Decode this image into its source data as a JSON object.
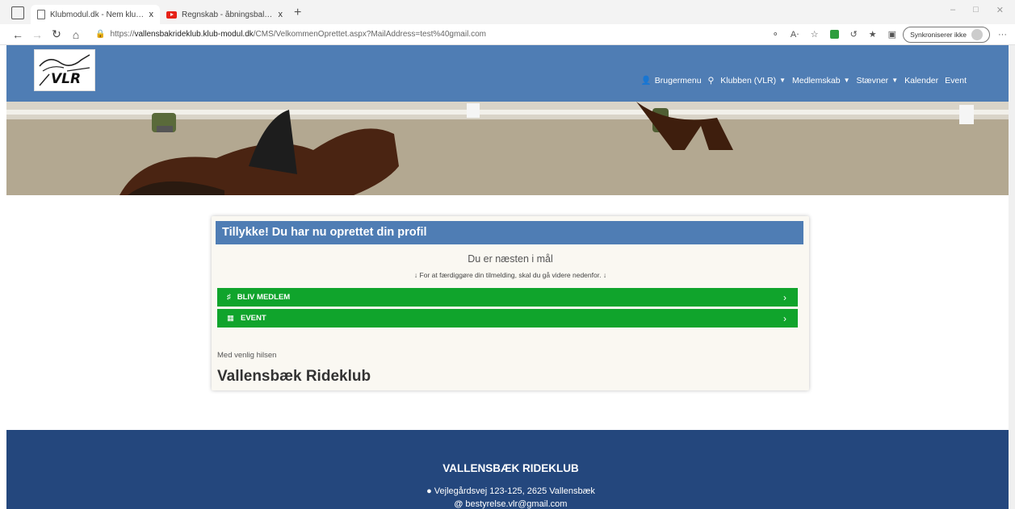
{
  "browser": {
    "tabs": [
      {
        "title": "Klubmodul.dk - Nem klubadmin",
        "close": "x",
        "favicon": "page-icon"
      },
      {
        "title": "Regnskab - åbningsbalance - Yo",
        "close": "x",
        "favicon": "youtube-icon"
      }
    ],
    "new_tab": "+",
    "url_scheme": "https://",
    "url_host": "vallensbakrideklub.klub-modul.dk",
    "url_path": "/CMS/VelkommenOprettet.aspx?MailAddress=test%40gmail.com",
    "sync_label": "Synkroniserer ikke",
    "more": "···"
  },
  "header": {
    "logo_text": "VLR",
    "menu": [
      {
        "icon": "user-icon",
        "label": "Brugermenu"
      },
      {
        "icon": "search-icon",
        "label": ""
      },
      {
        "label": "Klubben (VLR)",
        "dropdown": true
      },
      {
        "label": "Medlemskab",
        "dropdown": true
      },
      {
        "label": "Stævner",
        "dropdown": true
      },
      {
        "label": "Kalender"
      },
      {
        "label": "Event"
      }
    ]
  },
  "card": {
    "title": "Tillykke! Du har nu oprettet din profil",
    "subtitle": "Du er næsten i mål",
    "hint": "For at færdiggøre din tilmelding, skal du gå videre nedenfor.",
    "buttons": [
      {
        "icon": "users-icon",
        "label": "BLIV MEDLEM"
      },
      {
        "icon": "calendar-icon",
        "label": "EVENT"
      }
    ],
    "regards": "Med venlig hilsen",
    "signature": "Vallensbæk Rideklub"
  },
  "footer": {
    "title": "VALLENSBÆK RIDEKLUB",
    "address": "Vejlegårdsvej 123-125, 2625 Vallensbæk",
    "email": "bestyrelse.vlr@gmail.com"
  },
  "colors": {
    "header_blue": "#4f7db4",
    "button_green": "#10a42c",
    "footer_blue": "#24477d"
  }
}
